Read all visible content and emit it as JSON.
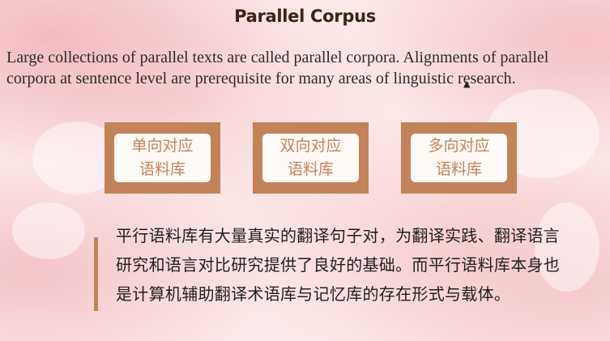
{
  "slide": {
    "title": "Parallel Corpus",
    "intro": "Large collections of parallel texts are called parallel corpora. Alignments of parallel corpora at sentence level are prerequisite for many areas of linguistic research.",
    "cards": [
      {
        "line1": "单向对应",
        "line2": "语料库"
      },
      {
        "line1": "双向对应",
        "line2": "语料库"
      },
      {
        "line1": "多向对应",
        "line2": "语料库"
      }
    ],
    "description": "平行语料库有大量真实的翻译句子对，为翻译实践、翻译语言研究和语言对比研究提供了良好的基础。而平行语料库本身也是计算机辅助翻译术语库与记忆库的存在形式与载体。"
  },
  "colors": {
    "accent": "#c3835a",
    "card_text": "#c4825a",
    "title": "#3a2418"
  },
  "icons": {
    "cursor": "mouse-cursor-icon"
  }
}
